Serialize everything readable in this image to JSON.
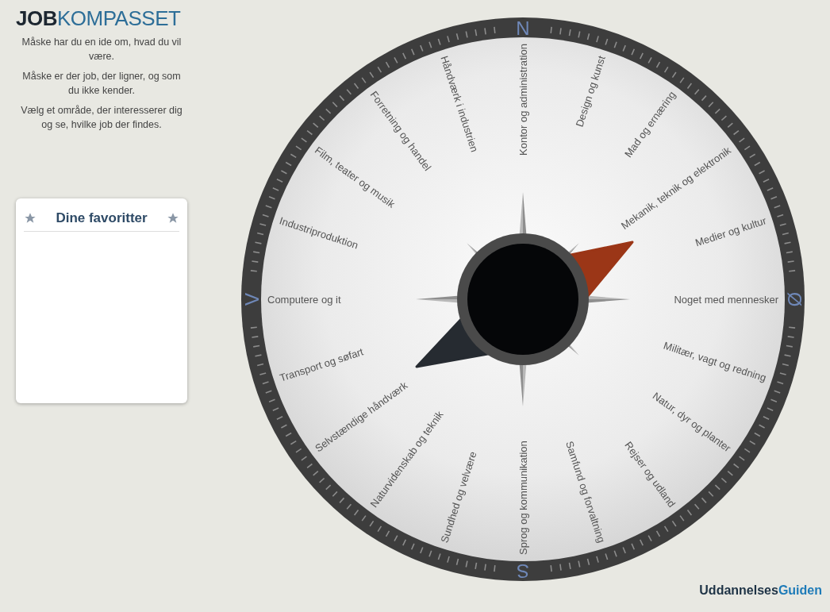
{
  "logo": {
    "bold": "JOB",
    "light": "KOMPASSET"
  },
  "intro": [
    "Måske har du en ide om, hvad du vil være.",
    "Måske er der job, der ligner, og som du ikke kender.",
    "Vælg et område, der interesserer dig og se, hvilke job der findes."
  ],
  "favorites": {
    "title": "Dine favoritter"
  },
  "compass": {
    "directions": [
      "N",
      "Ø",
      "S",
      "V"
    ],
    "west_categories": [
      "Håndværk i industrien",
      "Forretning og handel",
      "Film, teater og musik",
      "Industriproduktion",
      "Computere og it",
      "Transport og søfart",
      "Selvstændige håndværk",
      "Naturvidenskab og teknik",
      "Sundhed og velvære",
      "Sprog og kommunikation"
    ],
    "east_categories": [
      "Kontor og administration",
      "Design og kunst",
      "Mad og ernæring",
      "Mekanik, teknik og elektronik",
      "Medier og kultur",
      "Noget med mennesker",
      "Militær, vagt og redning",
      "Natur, dyr og planter",
      "Rejser og udland",
      "Samfund og forvaltning"
    ]
  },
  "footer_logo": {
    "dark": "Uddannelses",
    "light": "Guiden"
  }
}
